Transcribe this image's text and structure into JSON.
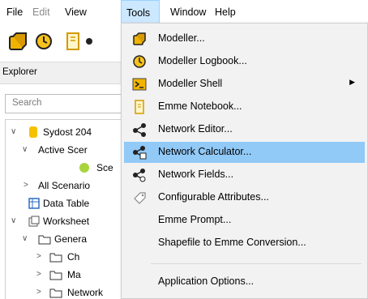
{
  "menubar": {
    "items": [
      {
        "label": "File",
        "state": "normal"
      },
      {
        "label": "Edit",
        "state": "disabled"
      },
      {
        "label": "View",
        "state": "normal"
      },
      {
        "label": "Tools",
        "state": "active"
      },
      {
        "label": "Window",
        "state": "normal"
      },
      {
        "label": "Help",
        "state": "normal"
      }
    ]
  },
  "toolbar": {
    "buttons": [
      "modeller-icon",
      "logbook-clock-icon",
      "notebook-icon",
      "more-icon"
    ]
  },
  "explorer": {
    "title": "Explorer",
    "search_placeholder": "Search",
    "tree": [
      {
        "label": "Sydost 204",
        "icon": "database-cylinder-icon"
      },
      {
        "label": "Active Scer",
        "icon": "none"
      },
      {
        "label": "Sce",
        "icon": "green-dot-icon"
      },
      {
        "label": "All Scenario",
        "icon": "none"
      },
      {
        "label": "Data Table",
        "icon": "table-icon"
      },
      {
        "label": "Worksheet",
        "icon": "worksheet-icon"
      },
      {
        "label": "Genera",
        "icon": "folder-icon"
      },
      {
        "label": "Ch",
        "icon": "folder-icon"
      },
      {
        "label": "Ma",
        "icon": "folder-icon"
      },
      {
        "label": "Network",
        "icon": "folder-icon"
      }
    ]
  },
  "tools_menu": {
    "highlight_color": "#91c9f7",
    "items": [
      {
        "label": "Modeller...",
        "icon": "modeller-icon"
      },
      {
        "label": "Modeller Logbook...",
        "icon": "clock-icon"
      },
      {
        "label": "Modeller Shell",
        "icon": "shell-icon",
        "submenu": true
      },
      {
        "label": "Emme Notebook...",
        "icon": "notebook-icon"
      },
      {
        "label": "Network Editor...",
        "icon": "network-icon"
      },
      {
        "label": "Network Calculator...",
        "icon": "network-calculator-icon",
        "highlighted": true
      },
      {
        "label": "Network Fields...",
        "icon": "network-fields-icon"
      },
      {
        "label": "Configurable Attributes...",
        "icon": "tag-icon"
      },
      {
        "label": "Emme Prompt...",
        "icon": "none"
      },
      {
        "label": "Shapefile to Emme Conversion...",
        "icon": "none"
      },
      {
        "label": "Application Options...",
        "icon": "none"
      }
    ],
    "submenu_arrow": "▶"
  }
}
